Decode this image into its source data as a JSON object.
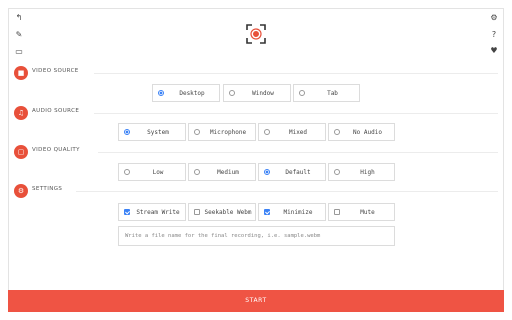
{
  "toolbar": {
    "icons": [
      "back-arrow-icon",
      "pen-icon",
      "monitor-icon",
      "gear-icon",
      "help-icon",
      "heart-icon"
    ],
    "glyphs": {
      "back": "↰",
      "pen": "✎",
      "monitor": "▭",
      "gear": "⚙",
      "help": "?",
      "heart": "♥"
    }
  },
  "brand_color": "#ef5444",
  "accent_color": "#3b82f6",
  "sections": {
    "video_source": {
      "label": "VIDEO SOURCE",
      "icon_glyph": "■",
      "options": [
        {
          "label": "Desktop",
          "selected": true
        },
        {
          "label": "Window",
          "selected": false
        },
        {
          "label": "Tab",
          "selected": false
        }
      ]
    },
    "audio_source": {
      "label": "AUDIO SOURCE",
      "icon_glyph": "♫",
      "options": [
        {
          "label": "System",
          "selected": true
        },
        {
          "label": "Microphone",
          "selected": false
        },
        {
          "label": "Mixed",
          "selected": false
        },
        {
          "label": "No Audio",
          "selected": false
        }
      ]
    },
    "video_quality": {
      "label": "VIDEO QUALITY",
      "icon_glyph": "▢",
      "options": [
        {
          "label": "Low",
          "selected": false
        },
        {
          "label": "Medium",
          "selected": false
        },
        {
          "label": "Default",
          "selected": true
        },
        {
          "label": "High",
          "selected": false
        }
      ]
    },
    "settings": {
      "label": "SETTINGS",
      "icon_glyph": "⚙",
      "options": [
        {
          "label": "Stream Write",
          "checked": true
        },
        {
          "label": "Seekable Webm",
          "checked": false
        },
        {
          "label": "Minimize",
          "checked": true
        },
        {
          "label": "Mute",
          "checked": false
        }
      ]
    }
  },
  "filename": {
    "placeholder": "Write a file name for the final recording, i.e. sample.webm",
    "value": ""
  },
  "start_label": "START"
}
